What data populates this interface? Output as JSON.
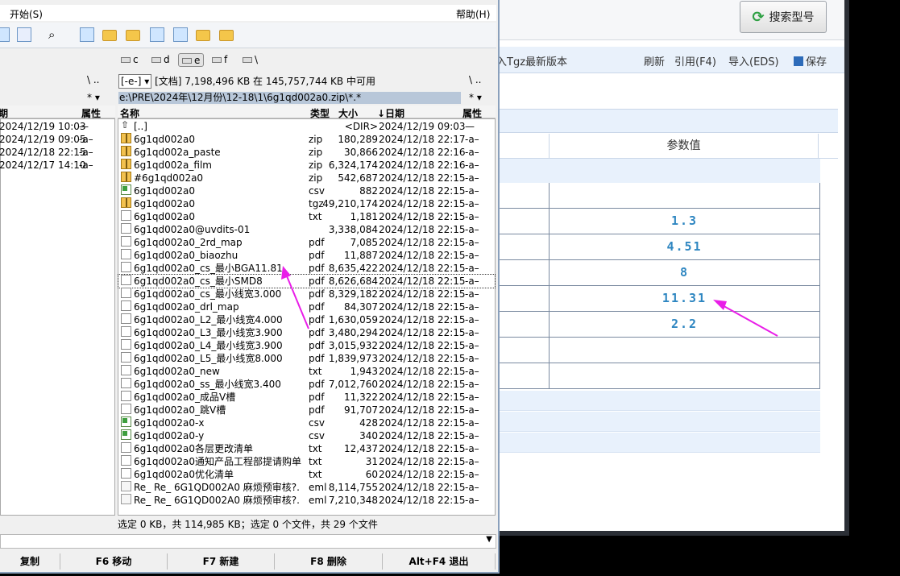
{
  "app_bg": {
    "search_button": "搜索型号",
    "toolbar": {
      "left_text": "入Tgz最新版本",
      "refresh": "刷新",
      "cite": "引用(F4)",
      "import": "导入(EDS)",
      "save": "保存"
    },
    "param_header": "参数值",
    "values": [
      "",
      "1.3",
      "4.51",
      "8",
      "11.31",
      "2.2",
      "",
      ""
    ]
  },
  "fm": {
    "menu": {
      "start": "开始(S)",
      "help": "帮助(H)"
    },
    "drives": [
      "c",
      "d",
      "e",
      "f",
      "\\"
    ],
    "active_drive": "e",
    "left_nav": "\\ ..",
    "right_nav": "\\ ..",
    "drive_select": "[-e-]",
    "drive_info": "[文档]  7,198,496 KB 在 145,757,744 KB 中可用",
    "path": "e:\\PRE\\2024年\\12月份\\12-18\\1\\6g1qd002a0.zip\\*.*",
    "filter": "* ▾",
    "left_headers": {
      "date": "期",
      "attr": "属性"
    },
    "right_headers": {
      "name": "名称",
      "type": "类型",
      "size": "大小",
      "date": "↓日期",
      "attr": "属性"
    },
    "left_rows": [
      {
        "date": "2024/12/19 10:03",
        "attr": "—"
      },
      {
        "date": "2024/12/19 09:05",
        "attr": "-a–"
      },
      {
        "date": "2024/12/18 22:15",
        "attr": "-a–"
      },
      {
        "date": "2024/12/17 14:10",
        "attr": "-a–"
      }
    ],
    "files": [
      {
        "icon": "up",
        "name": "[..]",
        "type": "",
        "size": "<DIR>",
        "date": "2024/12/19 09:03",
        "attr": "—"
      },
      {
        "icon": "zip",
        "name": "6g1qd002a0",
        "type": "zip",
        "size": "180,289",
        "date": "2024/12/18 22:17",
        "attr": "-a–"
      },
      {
        "icon": "zip",
        "name": "6g1qd002a_paste",
        "type": "zip",
        "size": "30,866",
        "date": "2024/12/18 22:16",
        "attr": "-a–"
      },
      {
        "icon": "zip",
        "name": "6g1qd002a_film",
        "type": "zip",
        "size": "6,324,174",
        "date": "2024/12/18 22:16",
        "attr": "-a–"
      },
      {
        "icon": "zip",
        "name": "#6g1qd002a0",
        "type": "zip",
        "size": "542,687",
        "date": "2024/12/18 22:15",
        "attr": "-a–"
      },
      {
        "icon": "csv",
        "name": "6g1qd002a0",
        "type": "csv",
        "size": "882",
        "date": "2024/12/18 22:15",
        "attr": "-a–"
      },
      {
        "icon": "zip",
        "name": "6g1qd002a0",
        "type": "tgz",
        "size": "49,210,174",
        "date": "2024/12/18 22:15",
        "attr": "-a–"
      },
      {
        "icon": "txt",
        "name": "6g1qd002a0",
        "type": "txt",
        "size": "1,181",
        "date": "2024/12/18 22:15",
        "attr": "-a–"
      },
      {
        "icon": "txt",
        "name": "6g1qd002a0@uvdits-01",
        "type": "",
        "size": "3,338,084",
        "date": "2024/12/18 22:15",
        "attr": "-a–"
      },
      {
        "icon": "pdf",
        "name": "6g1qd002a0_2rd_map",
        "type": "pdf",
        "size": "7,085",
        "date": "2024/12/18 22:15",
        "attr": "-a–"
      },
      {
        "icon": "pdf",
        "name": "6g1qd002a0_biaozhu",
        "type": "pdf",
        "size": "11,887",
        "date": "2024/12/18 22:15",
        "attr": "-a–"
      },
      {
        "icon": "pdf",
        "name": "6g1qd002a0_cs_最小BGA11.81",
        "type": "pdf",
        "size": "8,635,422",
        "date": "2024/12/18 22:15",
        "attr": "-a–"
      },
      {
        "icon": "pdf",
        "name": "6g1qd002a0_cs_最小SMD8",
        "type": "pdf",
        "size": "8,626,684",
        "date": "2024/12/18 22:15",
        "attr": "-a–"
      },
      {
        "icon": "pdf",
        "name": "6g1qd002a0_cs_最小线宽3.000",
        "type": "pdf",
        "size": "8,329,182",
        "date": "2024/12/18 22:15",
        "attr": "-a–"
      },
      {
        "icon": "pdf",
        "name": "6g1qd002a0_drl_map",
        "type": "pdf",
        "size": "84,307",
        "date": "2024/12/18 22:15",
        "attr": "-a–"
      },
      {
        "icon": "pdf",
        "name": "6g1qd002a0_L2_最小线宽4.000",
        "type": "pdf",
        "size": "1,630,059",
        "date": "2024/12/18 22:15",
        "attr": "-a–"
      },
      {
        "icon": "pdf",
        "name": "6g1qd002a0_L3_最小线宽3.900",
        "type": "pdf",
        "size": "3,480,294",
        "date": "2024/12/18 22:15",
        "attr": "-a–"
      },
      {
        "icon": "pdf",
        "name": "6g1qd002a0_L4_最小线宽3.900",
        "type": "pdf",
        "size": "3,015,932",
        "date": "2024/12/18 22:15",
        "attr": "-a–"
      },
      {
        "icon": "pdf",
        "name": "6g1qd002a0_L5_最小线宽8.000",
        "type": "pdf",
        "size": "1,839,973",
        "date": "2024/12/18 22:15",
        "attr": "-a–"
      },
      {
        "icon": "txt",
        "name": "6g1qd002a0_new",
        "type": "txt",
        "size": "1,943",
        "date": "2024/12/18 22:15",
        "attr": "-a–"
      },
      {
        "icon": "pdf",
        "name": "6g1qd002a0_ss_最小线宽3.400",
        "type": "pdf",
        "size": "7,012,760",
        "date": "2024/12/18 22:15",
        "attr": "-a–"
      },
      {
        "icon": "pdf",
        "name": "6g1qd002a0_成品V槽",
        "type": "pdf",
        "size": "11,322",
        "date": "2024/12/18 22:15",
        "attr": "-a–"
      },
      {
        "icon": "pdf",
        "name": "6g1qd002a0_跳V槽",
        "type": "pdf",
        "size": "91,707",
        "date": "2024/12/18 22:15",
        "attr": "-a–"
      },
      {
        "icon": "csv",
        "name": "6g1qd002a0-x",
        "type": "csv",
        "size": "428",
        "date": "2024/12/18 22:15",
        "attr": "-a–"
      },
      {
        "icon": "csv",
        "name": "6g1qd002a0-y",
        "type": "csv",
        "size": "340",
        "date": "2024/12/18 22:15",
        "attr": "-a–"
      },
      {
        "icon": "txt",
        "name": "6g1qd002a0各层更改清单",
        "type": "txt",
        "size": "12,437",
        "date": "2024/12/18 22:15",
        "attr": "-a–"
      },
      {
        "icon": "txt",
        "name": "6g1qd002a0通知产品工程部提请购单",
        "type": "txt",
        "size": "31",
        "date": "2024/12/18 22:15",
        "attr": "-a–"
      },
      {
        "icon": "txt",
        "name": "6g1qd002a0优化清单",
        "type": "txt",
        "size": "60",
        "date": "2024/12/18 22:15",
        "attr": "-a–"
      },
      {
        "icon": "eml",
        "name": "Re_ Re_ 6G1QD002A0 麻烦预审核?.",
        "type": "eml",
        "size": "8,114,755",
        "date": "2024/12/18 22:15",
        "attr": "-a–"
      },
      {
        "icon": "eml",
        "name": "Re_ Re_ 6G1QD002A0 麻烦预审核?.",
        "type": "eml",
        "size": "7,210,348",
        "date": "2024/12/18 22:15",
        "attr": "-a–"
      }
    ],
    "status": "选定 0 KB，共 114,985 KB；选定 0 个文件，共 29 个文件",
    "fkeys": [
      "复制",
      "F6 移动",
      "F7 新建",
      "F8 删除",
      "Alt+F4 退出"
    ]
  },
  "colors": {
    "arrow": "#e91ee8",
    "value_text": "#2e86c1",
    "selection_path": "#b8c7d9"
  }
}
